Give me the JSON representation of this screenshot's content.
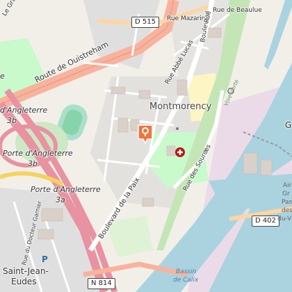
{
  "map": {
    "colors": {
      "water": "#aad3df",
      "motorway": "#e892a2",
      "trunk": "#f9b29c",
      "land": "#f2efe9",
      "residential": "#e0dfdf",
      "park": "#c8facc",
      "pitch": "#aae0cb",
      "marker": "#f0743c",
      "industrial": "#ebdbe8"
    },
    "places": {
      "district": "Montmorency",
      "saint_jean_line1": "Saint-Jean-",
      "saint_jean_line2": "Eudes"
    },
    "roads": {
      "route_oustreham": "Route de Ouistreham",
      "boulevard_paix": "Boulevard de la Paix",
      "rue_sources": "Rue des Sources",
      "rue_abbe_lucas": "Rue Abbé Lucas",
      "rue_mazarin": "Rue Mazarin",
      "rue_beaulue": "Rue de Beaulue",
      "boulevard_top": "Boulevard",
      "rue_docteur_garnier": "Rue du Docteur Garnier",
      "le_gran": "Le Gran",
      "rue_partial": "Rue",
      "voie_verte": "Voie Verte"
    },
    "interchange": {
      "pa3b_1": "Porte d'Angleterre",
      "pa3b_2": "3b",
      "pa3a_1": "Porte d'Angleterre",
      "pa3a_2": "3a",
      "pa3_1": "Porte d'Angleterre",
      "pa3_2": "3a",
      "left_partial1": "d'Angleterre",
      "left_partial2": "3b",
      "left_top": "e"
    },
    "shields": {
      "d515": "D 515",
      "d402": "D 402",
      "n814": "N 814"
    },
    "water_labels": {
      "bassin_1": "Bassin",
      "bassin_2": "de Calix"
    },
    "right_edge": {
      "r1": "Air",
      "r2": "Gr",
      "r3": "Pas",
      "r4": "des",
      "r5": "du-V",
      "g": "G"
    },
    "poi": {
      "parking": "P"
    }
  }
}
